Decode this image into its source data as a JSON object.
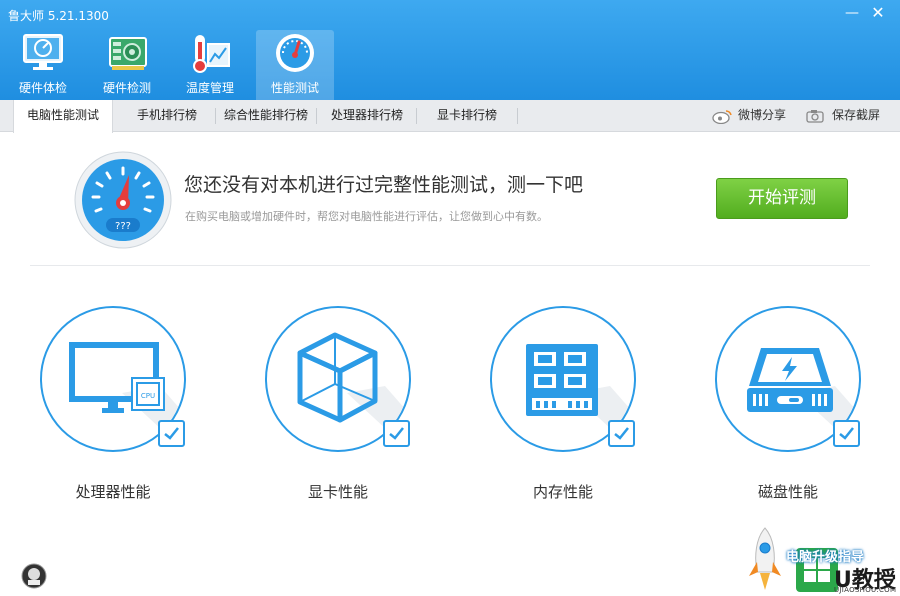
{
  "app": {
    "title": "鲁大师 5.21.1300"
  },
  "window_controls": {
    "minimize": "—",
    "close": "✕"
  },
  "toolbar": [
    {
      "label": "硬件体检",
      "icon": "monitor-icon"
    },
    {
      "label": "硬件检测",
      "icon": "circuit-board-icon"
    },
    {
      "label": "温度管理",
      "icon": "thermometer-icon"
    },
    {
      "label": "性能测试",
      "icon": "speedometer-icon",
      "active": true
    }
  ],
  "tabs": [
    {
      "label": "电脑性能测试",
      "active": true
    },
    {
      "label": "手机排行榜"
    },
    {
      "label": "综合性能排行榜"
    },
    {
      "label": "处理器排行榜"
    },
    {
      "label": "显卡排行榜"
    }
  ],
  "actions": {
    "weibo_share": "微博分享",
    "save_screenshot": "保存截屏"
  },
  "hero": {
    "headline": "您还没有对本机进行过完整性能测试，测一下吧",
    "subline": "在购买电脑或增加硬件时，帮您对电脑性能进行评估，让您做到心中有数。",
    "gauge_value": "???",
    "start_button": "开始评测"
  },
  "items": [
    {
      "label": "处理器性能",
      "icon": "cpu-monitor-icon",
      "checked": true,
      "chip_label": "CPU"
    },
    {
      "label": "显卡性能",
      "icon": "cube-icon",
      "checked": true
    },
    {
      "label": "内存性能",
      "icon": "memory-module-icon",
      "checked": true
    },
    {
      "label": "磁盘性能",
      "icon": "hard-disk-icon",
      "checked": true
    }
  ],
  "promo": {
    "text": "电脑升级指导",
    "brand": "U教授",
    "domain": "UJIAOSHOU.COM"
  },
  "colors": {
    "accent": "#2b9be6",
    "toolbar": "#2590e0",
    "start": "#5ab92a"
  }
}
